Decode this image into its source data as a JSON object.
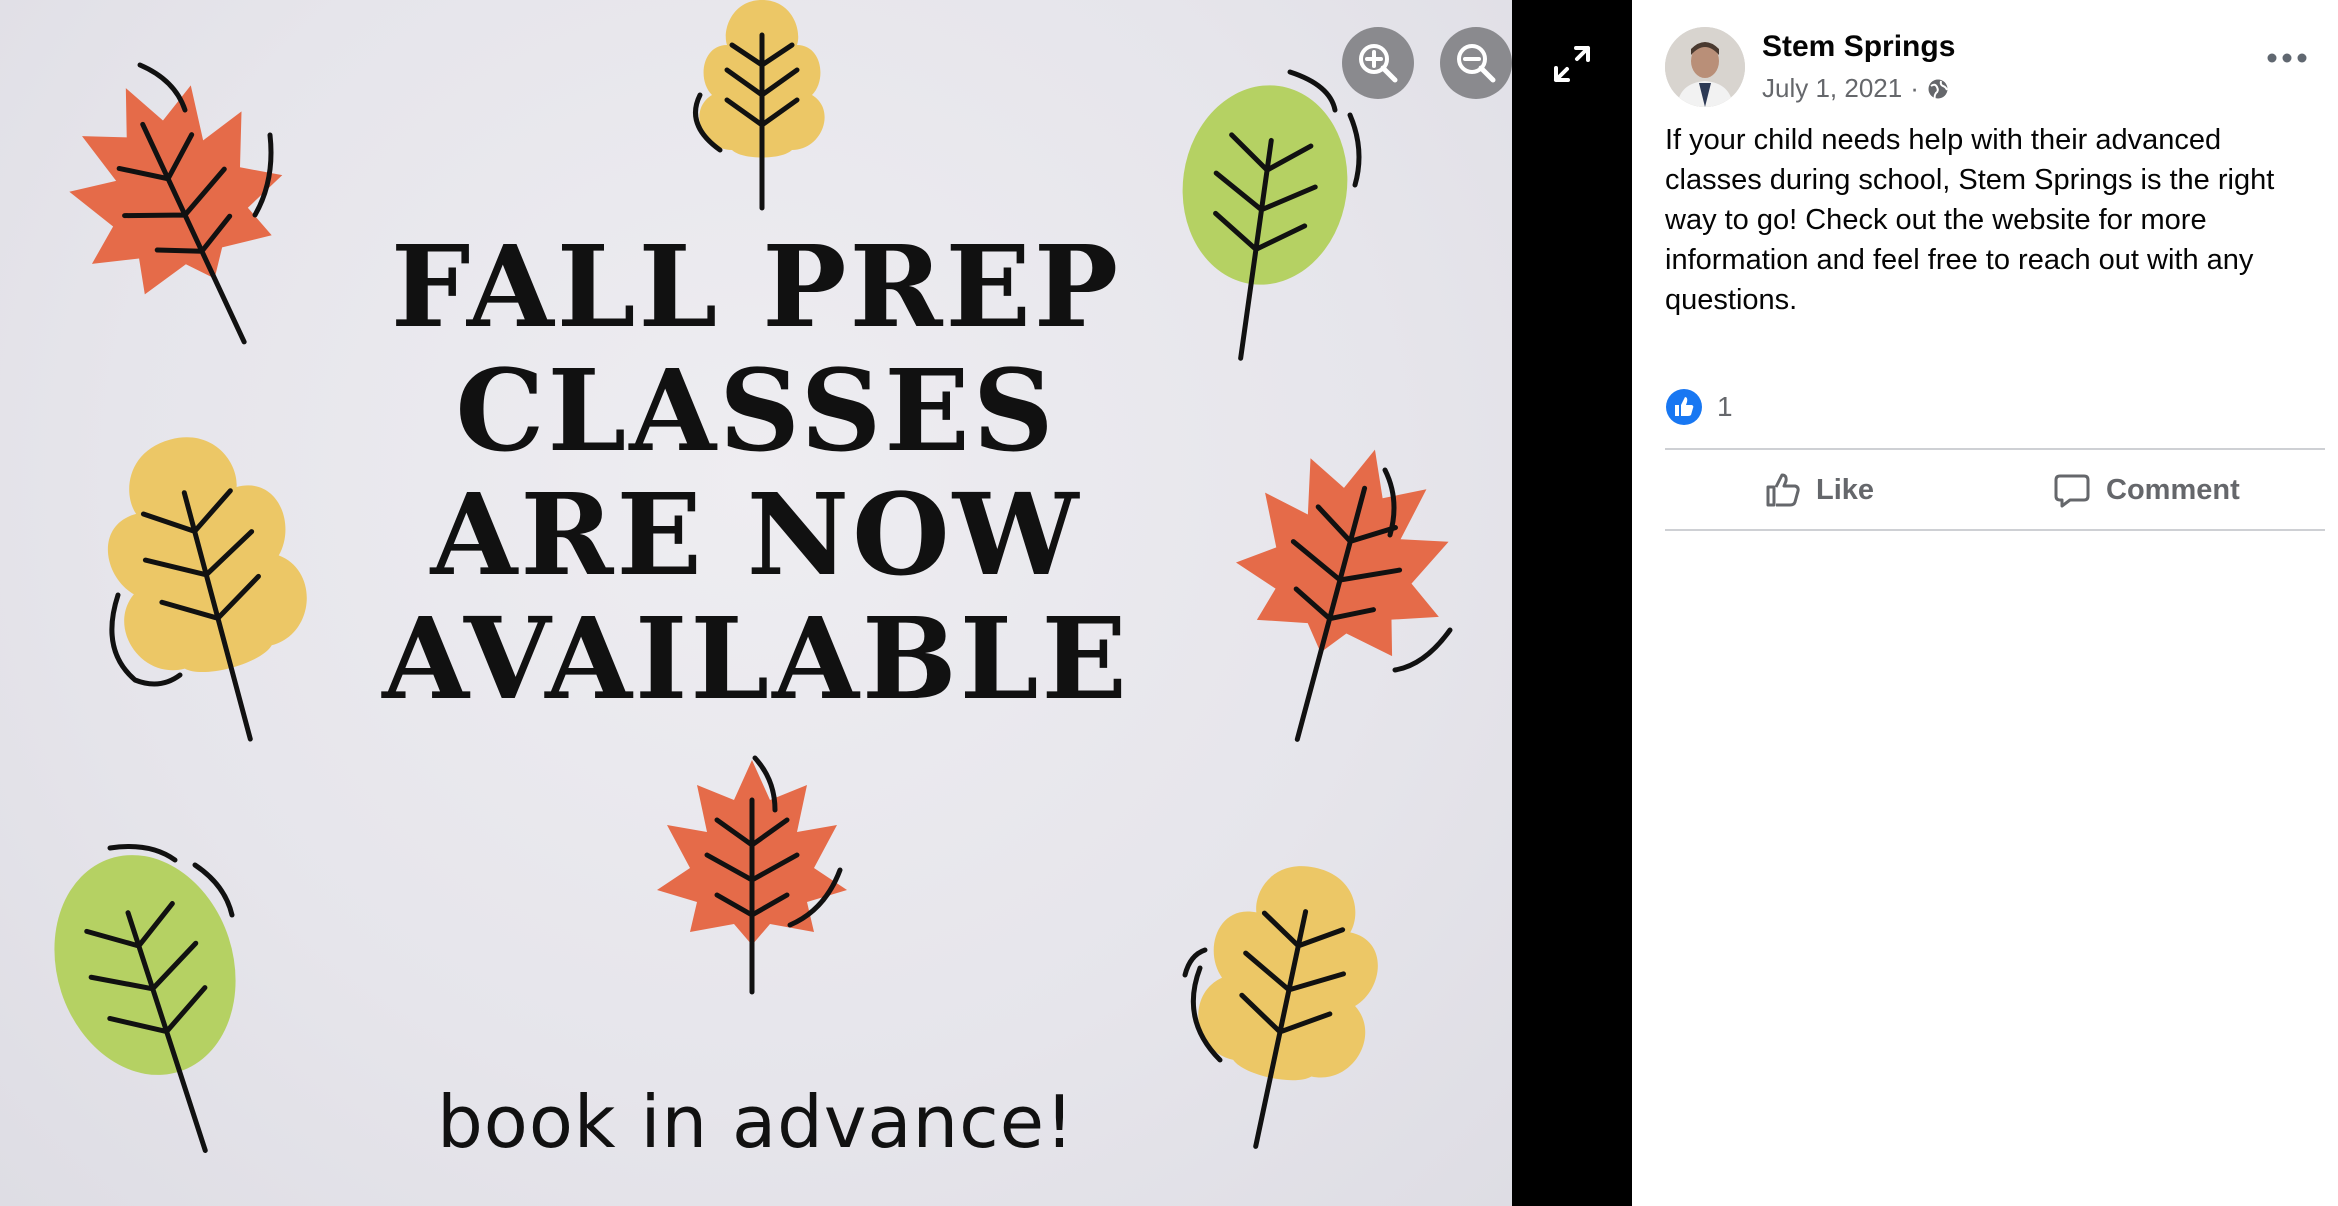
{
  "photo": {
    "headline": [
      "FALL PREP",
      "CLASSES",
      "ARE NOW",
      "AVAILABLE"
    ],
    "tagline": "book in advance!",
    "colors": {
      "orange_leaf": "#e56b49",
      "yellow_leaf": "#ecc766",
      "green_leaf": "#b5d163"
    }
  },
  "viewer_controls": {
    "zoom_in_icon": "zoom-in-icon",
    "zoom_out_icon": "zoom-out-icon",
    "fullscreen_icon": "expand-icon"
  },
  "post": {
    "author": "Stem Springs",
    "date": "July 1, 2021",
    "separator": "·",
    "audience_icon": "globe-icon",
    "text": "If your child needs help with their advanced classes during school, Stem Springs is the right way to go! Check out the website for more information and feel free to reach out with any questions.",
    "reactions": {
      "count": "1",
      "icon": "like-reaction-icon",
      "color": "#1877f2"
    },
    "actions": {
      "like_label": "Like",
      "comment_label": "Comment"
    }
  }
}
